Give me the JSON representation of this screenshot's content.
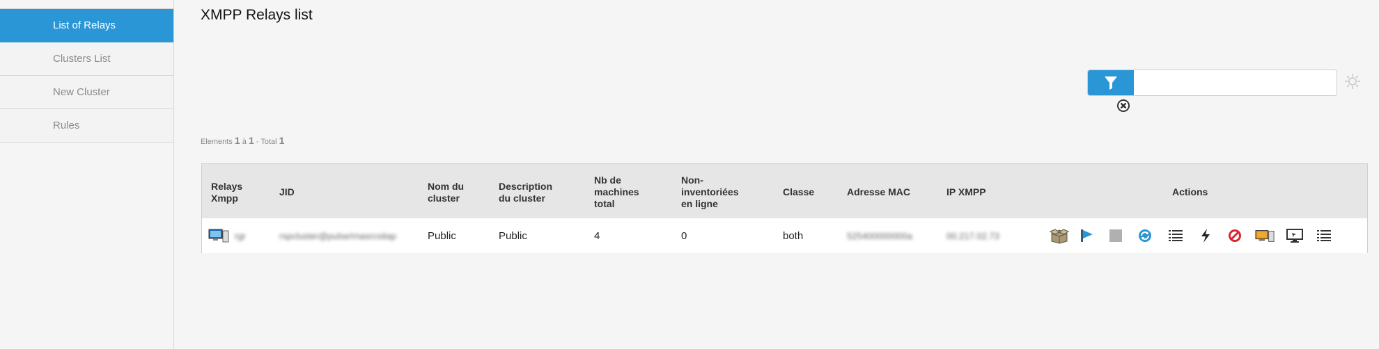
{
  "sidebar": {
    "items": [
      {
        "label": "List of Relays",
        "active": true
      },
      {
        "label": "Clusters List"
      },
      {
        "label": "New Cluster"
      },
      {
        "label": "Rules"
      }
    ]
  },
  "page": {
    "title": "XMPP Relays list"
  },
  "filter": {
    "placeholder": "",
    "value": ""
  },
  "pager": {
    "prefix": "Elements",
    "from": "1",
    "sep": "à",
    "to": "1",
    "total_label": "- Total",
    "total": "1"
  },
  "table": {
    "headers": {
      "relay": [
        "Relays",
        "Xmpp"
      ],
      "jid": [
        "JID"
      ],
      "cluster_name": [
        "Nom du",
        "cluster"
      ],
      "cluster_desc": [
        "Description",
        "du cluster"
      ],
      "nb_total": [
        "Nb de",
        "machines",
        "total"
      ],
      "non_inv": [
        "Non-",
        "inventoriées",
        "en ligne"
      ],
      "classe": [
        "Classe"
      ],
      "mac": [
        "Adresse MAC"
      ],
      "ip": [
        "IP XMPP"
      ],
      "actions": [
        "Actions"
      ]
    },
    "rows": [
      {
        "relay": "rgr",
        "jid": "rspcluster@pulse/rnasrcsitap",
        "cluster_name": "Public",
        "cluster_desc": "Public",
        "nb_total": "4",
        "non_inv": "0",
        "classe": "both",
        "mac": "525400000000a",
        "ip": "00.217.02.73"
      }
    ]
  },
  "actions_icons": [
    "package-icon",
    "flag-icon",
    "stop-icon",
    "refresh-icon",
    "list-icon",
    "lightning-icon",
    "forbidden-icon",
    "computer-icon",
    "monitor-icon",
    "list-icon"
  ],
  "colors": {
    "accent": "#2a96d6"
  }
}
